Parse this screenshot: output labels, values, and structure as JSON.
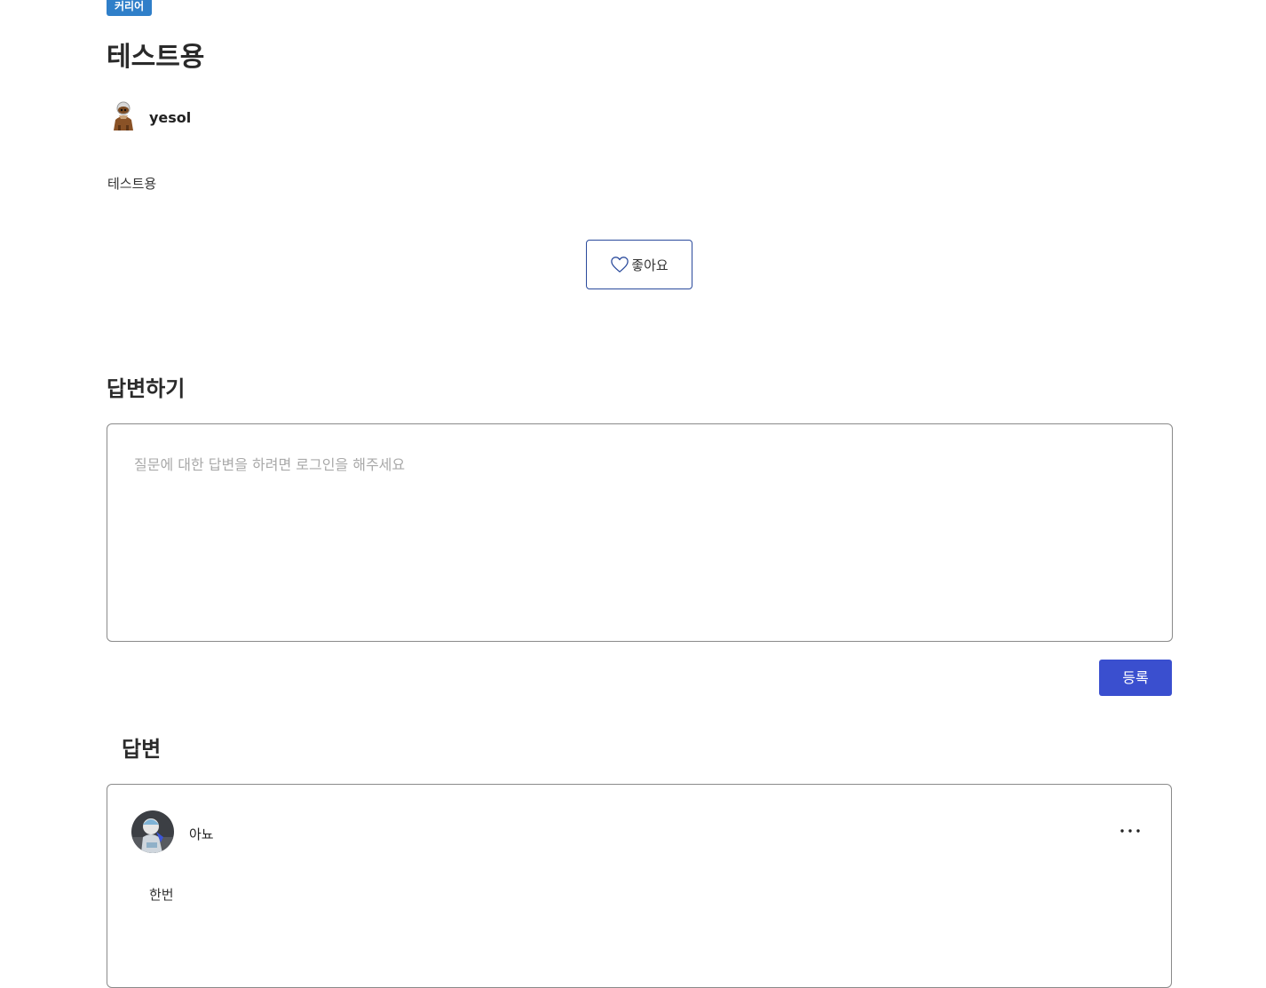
{
  "post": {
    "category": "커리어",
    "title": "테스트용",
    "author": "yesol",
    "body": "테스트용",
    "like_label": "좋아요"
  },
  "answer_form": {
    "title": "답변하기",
    "placeholder": "질문에 대한 답변을 하려면 로그인을 해주세요",
    "submit_label": "등록"
  },
  "answers": {
    "title": "답변",
    "items": [
      {
        "author": "아뇨",
        "content": "한번"
      }
    ]
  },
  "colors": {
    "badge": "#2f7fc9",
    "like_border": "#2a4a9c",
    "submit": "#3a4fcf"
  },
  "icons": {
    "like": "heart-icon",
    "more": "more-horizontal-icon"
  }
}
